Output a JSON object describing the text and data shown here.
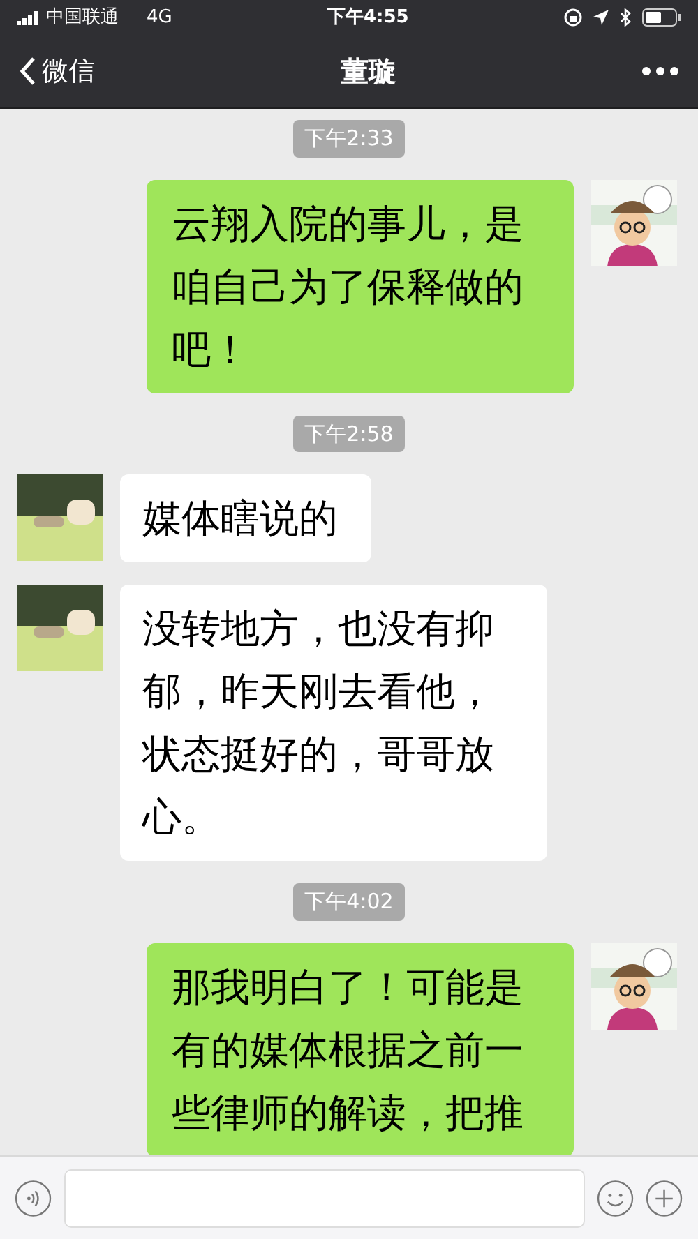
{
  "status_bar": {
    "carrier": "中国联通",
    "network": "4G",
    "time": "下午4:55"
  },
  "nav": {
    "back_label": "微信",
    "title": "董璇"
  },
  "messages": [
    {
      "kind": "time",
      "text": "下午2:33"
    },
    {
      "kind": "sent",
      "text": "云翔入院的事儿，是咱自己为了保释做的吧！"
    },
    {
      "kind": "time",
      "text": "下午2:58"
    },
    {
      "kind": "received",
      "text": "媒体瞎说的"
    },
    {
      "kind": "received",
      "text": "没转地方，也没有抑郁，昨天刚去看他，状态挺好的，哥哥放心。"
    },
    {
      "kind": "time",
      "text": "下午4:02"
    },
    {
      "kind": "sent",
      "text": "那我明白了！可能是有的媒体根据之前一些律师的解读，把推"
    }
  ]
}
